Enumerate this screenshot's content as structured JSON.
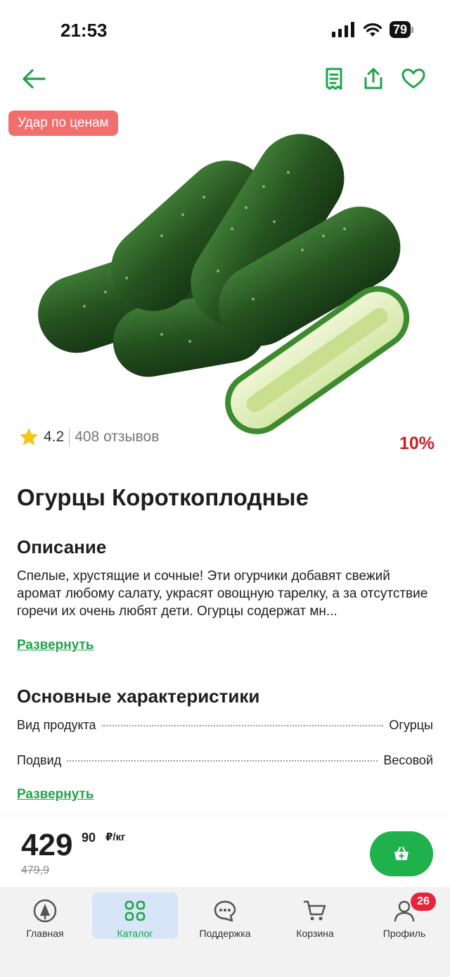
{
  "status_bar": {
    "time": "21:53",
    "battery": "79"
  },
  "header": {
    "promo_badge": "Удар по ценам"
  },
  "rating": {
    "score": "4.2",
    "reviews": "408 отзывов"
  },
  "discount": "10%",
  "product": {
    "title": "Огурцы Короткоплодные",
    "description_heading": "Описание",
    "description": "Спелые, хрустящие и сочные! Эти огурчики добавят свежий аромат любому салату, украсят овощную тарелку, а за отсутствие горечи их очень любят дети. Огурцы содержат мн...",
    "expand_label": "Развернуть",
    "specs_heading": "Основные характеристики",
    "specs": [
      {
        "name": "Вид продукта",
        "value": "Огурцы"
      },
      {
        "name": "Подвид",
        "value": "Весовой"
      }
    ],
    "specs_expand_label": "Развернуть"
  },
  "price": {
    "rubles": "429",
    "kopecks": "90",
    "unit": "₽/кг",
    "old": "479,9"
  },
  "tabs": [
    {
      "label": "Главная"
    },
    {
      "label": "Каталог"
    },
    {
      "label": "Поддержка"
    },
    {
      "label": "Корзина"
    },
    {
      "label": "Профиль"
    }
  ],
  "profile_badge": "26",
  "colors": {
    "accent_green": "#1fb14c",
    "link_green": "#1fa34a",
    "discount_red": "#cc1f2a",
    "promo_badge": "#f26d6d",
    "active_tab": "#d7e5f8"
  }
}
